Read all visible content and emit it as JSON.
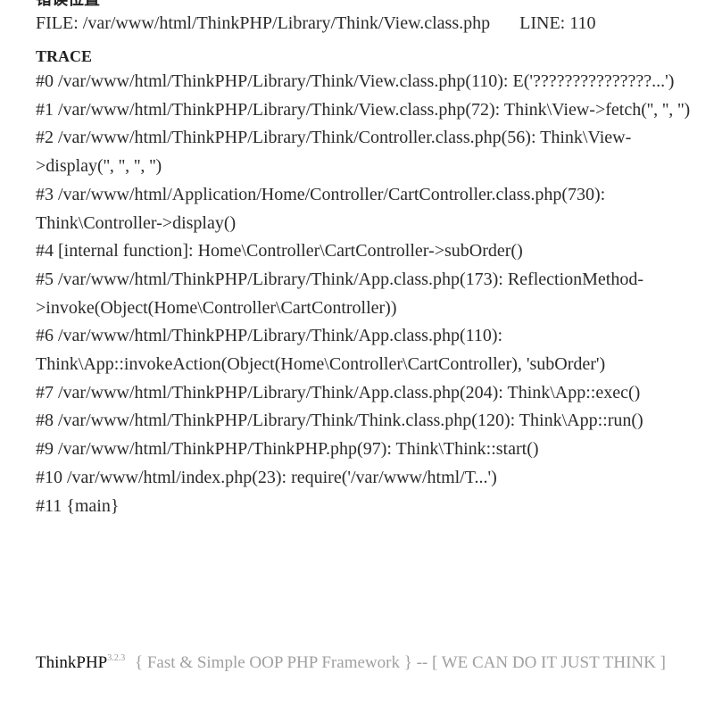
{
  "error_location": {
    "heading": "错误位置",
    "file_label": "FILE:",
    "file_path": "/var/www/html/ThinkPHP/Library/Think/View.class.php",
    "line_label": "LINE:",
    "line_number": "110"
  },
  "trace": {
    "title": "TRACE",
    "lines": [
      "#0 /var/www/html/ThinkPHP/Library/Think/View.class.php(110): E('???????????????...')",
      "#1 /var/www/html/ThinkPHP/Library/Think/View.class.php(72): Think\\View->fetch('', '', '')",
      "#2 /var/www/html/ThinkPHP/Library/Think/Controller.class.php(56): Think\\View->display('', '', '', '')",
      "#3 /var/www/html/Application/Home/Controller/CartController.class.php(730): Think\\Controller->display()",
      "#4 [internal function]: Home\\Controller\\CartController->subOrder()",
      "#5 /var/www/html/ThinkPHP/Library/Think/App.class.php(173): ReflectionMethod->invoke(Object(Home\\Controller\\CartController))",
      "#6 /var/www/html/ThinkPHP/Library/Think/App.class.php(110): Think\\App::invokeAction(Object(Home\\Controller\\CartController), 'subOrder')",
      "#7 /var/www/html/ThinkPHP/Library/Think/App.class.php(204): Think\\App::exec()",
      "#8 /var/www/html/ThinkPHP/Library/Think/Think.class.php(120): Think\\App::run()",
      "#9 /var/www/html/ThinkPHP/ThinkPHP.php(97): Think\\Think::start()",
      "#10 /var/www/html/index.php(23): require('/var/www/html/T...')",
      "#11 {main}"
    ]
  },
  "footer": {
    "brand": "ThinkPHP",
    "version": "3.2.3",
    "slogan": "{ Fast & Simple OOP PHP Framework } -- [ WE CAN DO IT JUST THINK ]"
  }
}
